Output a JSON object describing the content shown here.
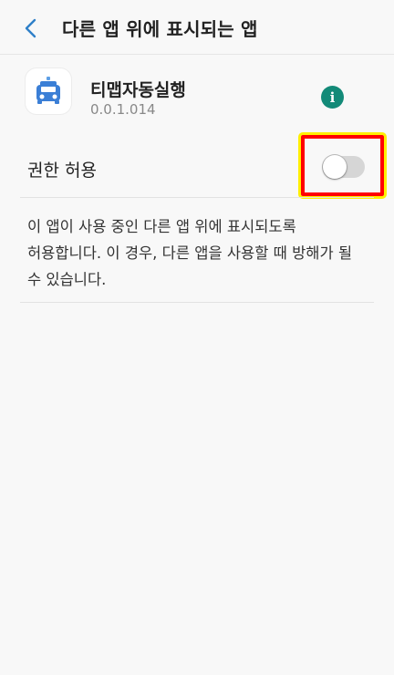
{
  "header": {
    "title": "다른 앱 위에 표시되는 앱",
    "back_icon": "chevron-left-icon"
  },
  "app": {
    "name": "티맵자동실행",
    "version": "0.0.1.014",
    "icon": "car-icon",
    "icon_color": "#3b7fd6",
    "info_label": "i",
    "info_color": "#138a78"
  },
  "permission": {
    "label": "권한 허용",
    "toggle_on": false
  },
  "description": {
    "line1": "이 앱이 사용 중인 다른 앱 위에 표시되도록",
    "line2": "허용합니다. 이 경우, 다른 앱을 사용할 때 방해가 될",
    "line3": "수 있습니다."
  },
  "colors": {
    "accent": "#2f80c8",
    "highlight_border": "#ff0000",
    "highlight_outline": "#ffef00"
  }
}
